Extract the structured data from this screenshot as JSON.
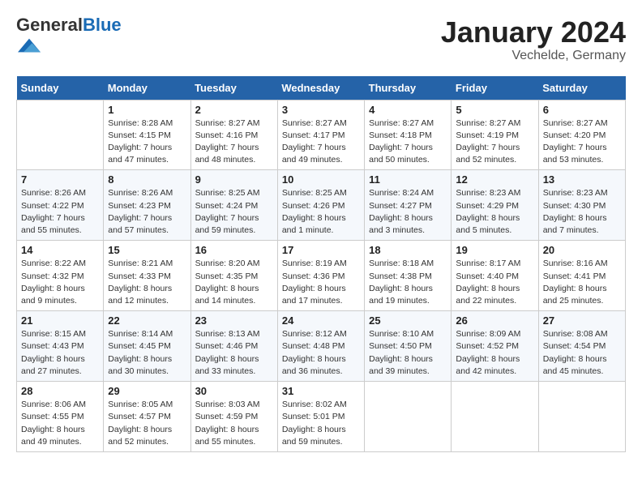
{
  "header": {
    "logo_general": "General",
    "logo_blue": "Blue",
    "title": "January 2024",
    "subtitle": "Vechelde, Germany"
  },
  "days_of_week": [
    "Sunday",
    "Monday",
    "Tuesday",
    "Wednesday",
    "Thursday",
    "Friday",
    "Saturday"
  ],
  "weeks": [
    [
      {
        "day": null
      },
      {
        "day": "1",
        "sunrise": "8:28 AM",
        "sunset": "4:15 PM",
        "daylight": "7 hours and 47 minutes."
      },
      {
        "day": "2",
        "sunrise": "8:27 AM",
        "sunset": "4:16 PM",
        "daylight": "7 hours and 48 minutes."
      },
      {
        "day": "3",
        "sunrise": "8:27 AM",
        "sunset": "4:17 PM",
        "daylight": "7 hours and 49 minutes."
      },
      {
        "day": "4",
        "sunrise": "8:27 AM",
        "sunset": "4:18 PM",
        "daylight": "7 hours and 50 minutes."
      },
      {
        "day": "5",
        "sunrise": "8:27 AM",
        "sunset": "4:19 PM",
        "daylight": "7 hours and 52 minutes."
      },
      {
        "day": "6",
        "sunrise": "8:27 AM",
        "sunset": "4:20 PM",
        "daylight": "7 hours and 53 minutes."
      }
    ],
    [
      {
        "day": "7",
        "sunrise": "8:26 AM",
        "sunset": "4:22 PM",
        "daylight": "7 hours and 55 minutes."
      },
      {
        "day": "8",
        "sunrise": "8:26 AM",
        "sunset": "4:23 PM",
        "daylight": "7 hours and 57 minutes."
      },
      {
        "day": "9",
        "sunrise": "8:25 AM",
        "sunset": "4:24 PM",
        "daylight": "7 hours and 59 minutes."
      },
      {
        "day": "10",
        "sunrise": "8:25 AM",
        "sunset": "4:26 PM",
        "daylight": "8 hours and 1 minute."
      },
      {
        "day": "11",
        "sunrise": "8:24 AM",
        "sunset": "4:27 PM",
        "daylight": "8 hours and 3 minutes."
      },
      {
        "day": "12",
        "sunrise": "8:23 AM",
        "sunset": "4:29 PM",
        "daylight": "8 hours and 5 minutes."
      },
      {
        "day": "13",
        "sunrise": "8:23 AM",
        "sunset": "4:30 PM",
        "daylight": "8 hours and 7 minutes."
      }
    ],
    [
      {
        "day": "14",
        "sunrise": "8:22 AM",
        "sunset": "4:32 PM",
        "daylight": "8 hours and 9 minutes."
      },
      {
        "day": "15",
        "sunrise": "8:21 AM",
        "sunset": "4:33 PM",
        "daylight": "8 hours and 12 minutes."
      },
      {
        "day": "16",
        "sunrise": "8:20 AM",
        "sunset": "4:35 PM",
        "daylight": "8 hours and 14 minutes."
      },
      {
        "day": "17",
        "sunrise": "8:19 AM",
        "sunset": "4:36 PM",
        "daylight": "8 hours and 17 minutes."
      },
      {
        "day": "18",
        "sunrise": "8:18 AM",
        "sunset": "4:38 PM",
        "daylight": "8 hours and 19 minutes."
      },
      {
        "day": "19",
        "sunrise": "8:17 AM",
        "sunset": "4:40 PM",
        "daylight": "8 hours and 22 minutes."
      },
      {
        "day": "20",
        "sunrise": "8:16 AM",
        "sunset": "4:41 PM",
        "daylight": "8 hours and 25 minutes."
      }
    ],
    [
      {
        "day": "21",
        "sunrise": "8:15 AM",
        "sunset": "4:43 PM",
        "daylight": "8 hours and 27 minutes."
      },
      {
        "day": "22",
        "sunrise": "8:14 AM",
        "sunset": "4:45 PM",
        "daylight": "8 hours and 30 minutes."
      },
      {
        "day": "23",
        "sunrise": "8:13 AM",
        "sunset": "4:46 PM",
        "daylight": "8 hours and 33 minutes."
      },
      {
        "day": "24",
        "sunrise": "8:12 AM",
        "sunset": "4:48 PM",
        "daylight": "8 hours and 36 minutes."
      },
      {
        "day": "25",
        "sunrise": "8:10 AM",
        "sunset": "4:50 PM",
        "daylight": "8 hours and 39 minutes."
      },
      {
        "day": "26",
        "sunrise": "8:09 AM",
        "sunset": "4:52 PM",
        "daylight": "8 hours and 42 minutes."
      },
      {
        "day": "27",
        "sunrise": "8:08 AM",
        "sunset": "4:54 PM",
        "daylight": "8 hours and 45 minutes."
      }
    ],
    [
      {
        "day": "28",
        "sunrise": "8:06 AM",
        "sunset": "4:55 PM",
        "daylight": "8 hours and 49 minutes."
      },
      {
        "day": "29",
        "sunrise": "8:05 AM",
        "sunset": "4:57 PM",
        "daylight": "8 hours and 52 minutes."
      },
      {
        "day": "30",
        "sunrise": "8:03 AM",
        "sunset": "4:59 PM",
        "daylight": "8 hours and 55 minutes."
      },
      {
        "day": "31",
        "sunrise": "8:02 AM",
        "sunset": "5:01 PM",
        "daylight": "8 hours and 59 minutes."
      },
      {
        "day": null
      },
      {
        "day": null
      },
      {
        "day": null
      }
    ]
  ],
  "labels": {
    "sunrise": "Sunrise:",
    "sunset": "Sunset:",
    "daylight": "Daylight:"
  }
}
